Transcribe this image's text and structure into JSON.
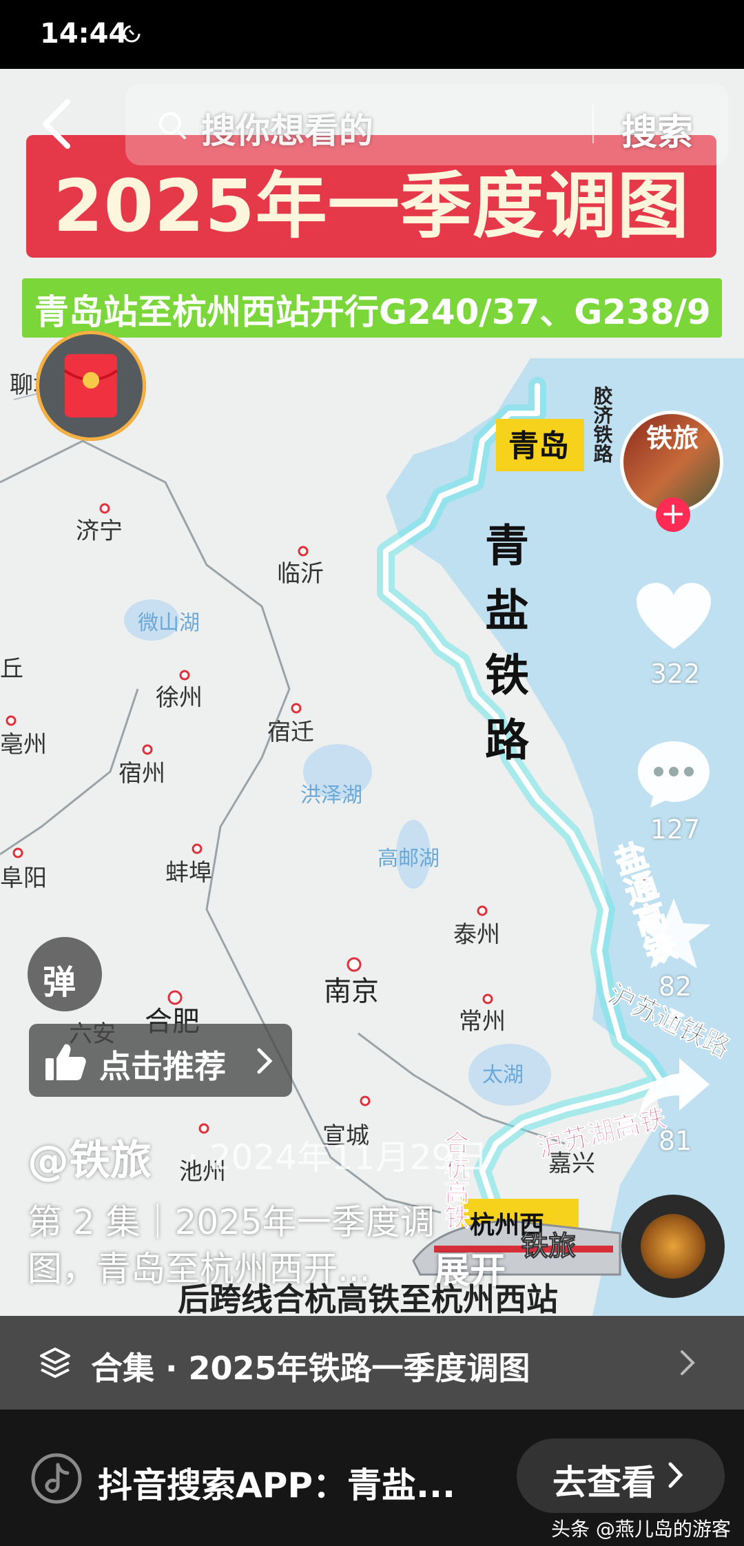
{
  "status_bar": {
    "time": "14:44"
  },
  "search": {
    "placeholder": "搜你想看的",
    "button_label": "搜索"
  },
  "video": {
    "title": "2025年一季度调图",
    "subtitle": "青岛站至杭州西站开行G240/37、G238/9",
    "map_labels": {
      "liaocheng": "聊城",
      "qingdao": "青岛",
      "jiaoji": "胶济铁路",
      "jining": "济宁",
      "linyi": "临沂",
      "weishan_lake": "微山湖",
      "xuzhou": "徐州",
      "suqian": "宿迁",
      "suzhou": "宿州",
      "hongze_lake": "洪泽湖",
      "gaoyou_lake": "高邮湖",
      "bengbu": "蚌埠",
      "fuyang": "阜阳",
      "taizhou": "泰州",
      "nanjing": "南京",
      "changzhou": "常州",
      "hefei": "合肥",
      "luan": "六安",
      "taihu": "太湖",
      "xuancheng": "宣城",
      "chizhou": "池州",
      "jiaxing": "嘉兴",
      "qingyan": "青盐铁路",
      "yantong": "盐通高铁",
      "hsutong": "沪苏通铁路",
      "husuhu": "沪苏湖高铁",
      "hehang": "合杭高铁",
      "qiu": "丘",
      "bozhou_partial": "亳州",
      "station_partial": "杭州西",
      "channel_tag": "铁旅"
    },
    "caption": "后跨线合杭高铁至杭州西站"
  },
  "author": {
    "avatar_text": "铁旅",
    "handle": "@铁旅",
    "date": "· 2024年11月29日"
  },
  "actions": {
    "likes": "322",
    "comments": "127",
    "favorites": "82",
    "shares": "81"
  },
  "overlays": {
    "danmu": "弹",
    "recommend": "点击推荐"
  },
  "description": {
    "line1": "第 2 集｜2025年一季度调",
    "line2": "图，青岛至杭州西开...",
    "expand": "展开"
  },
  "collection": {
    "label": "合集 · 2025年铁路一季度调图"
  },
  "bottom": {
    "search_app": "抖音搜索APP：青盐...",
    "go_button": "去查看"
  },
  "watermark": "头条 @燕儿岛的游客",
  "colors": {
    "title_red": "#e5394a",
    "subtitle_green": "#7bd63a",
    "route_cyan": "#6fe3ea",
    "accent_pink": "#fe2c55"
  }
}
